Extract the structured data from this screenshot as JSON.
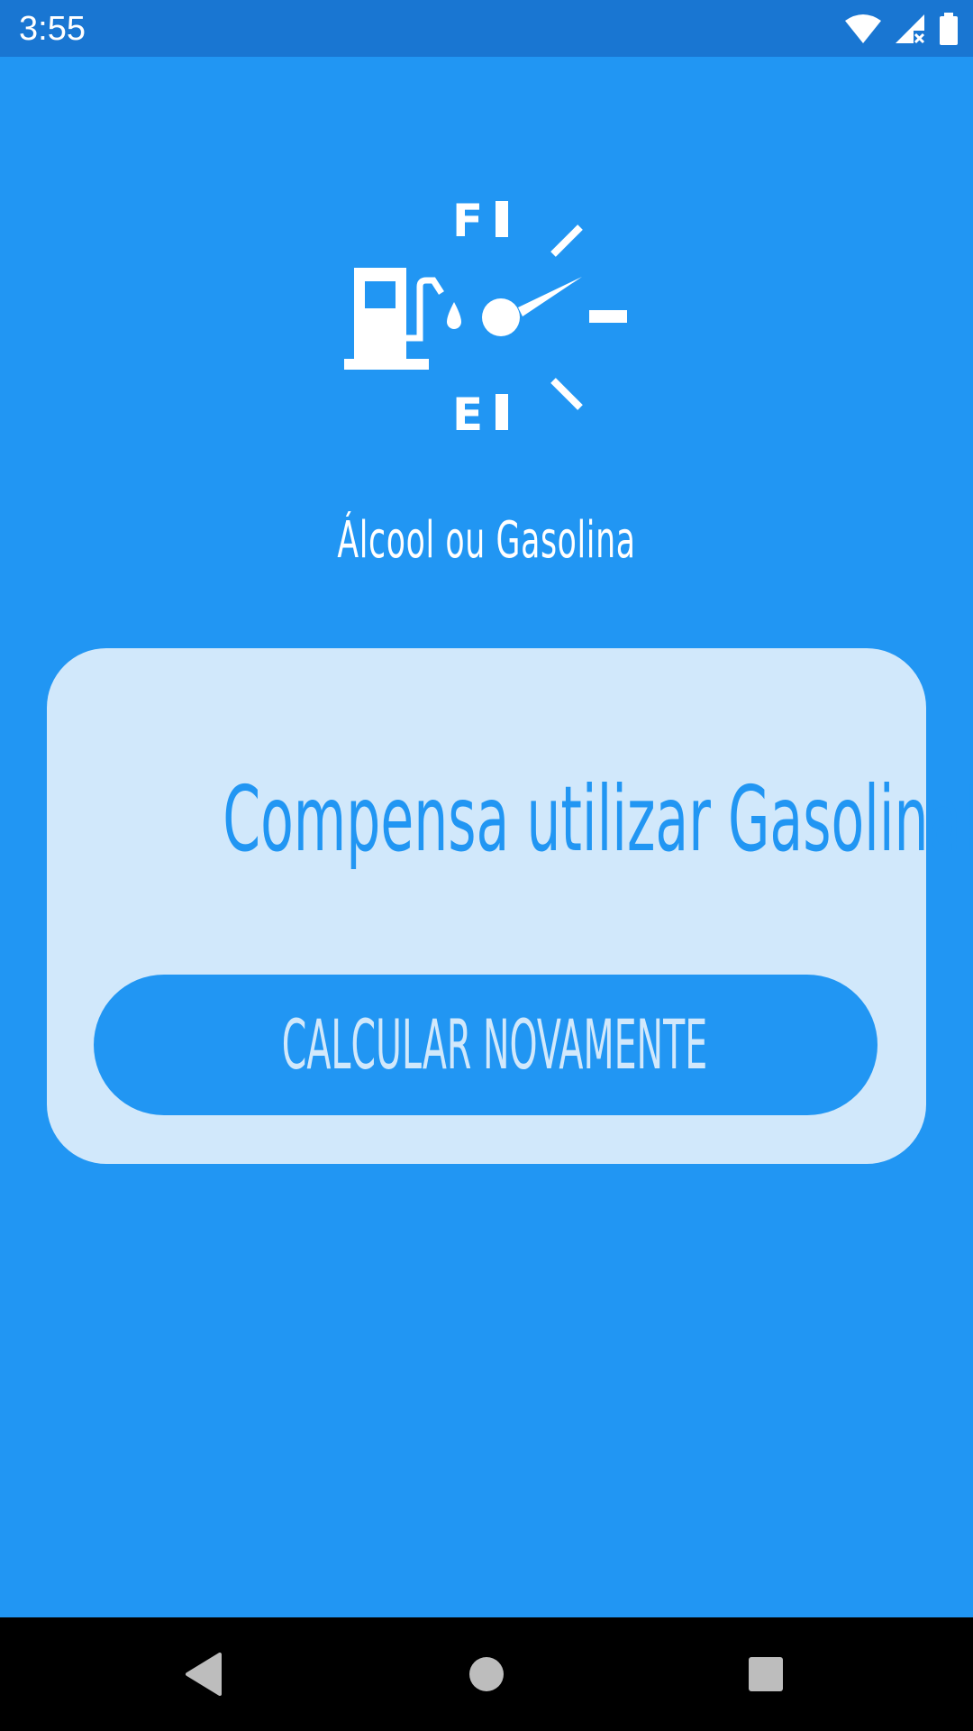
{
  "status_bar": {
    "time": "3:55",
    "icons": [
      "wifi-icon",
      "signal-icon",
      "battery-icon"
    ]
  },
  "app": {
    "logo_icon": "fuel-gauge-icon",
    "logo_letters": {
      "full": "F",
      "empty": "E"
    },
    "title": "Álcool ou Gasolina"
  },
  "result": {
    "message": "Compensa utilizar Gasolina!",
    "button_label": "CALCULAR NOVAMENTE"
  },
  "nav_bar": {
    "icons": [
      "back-icon",
      "home-icon",
      "recent-apps-icon"
    ]
  },
  "colors": {
    "background": "#2196F3",
    "status_bar": "#1976D2",
    "card": "#D1E8FB",
    "accent": "#2196F3"
  }
}
